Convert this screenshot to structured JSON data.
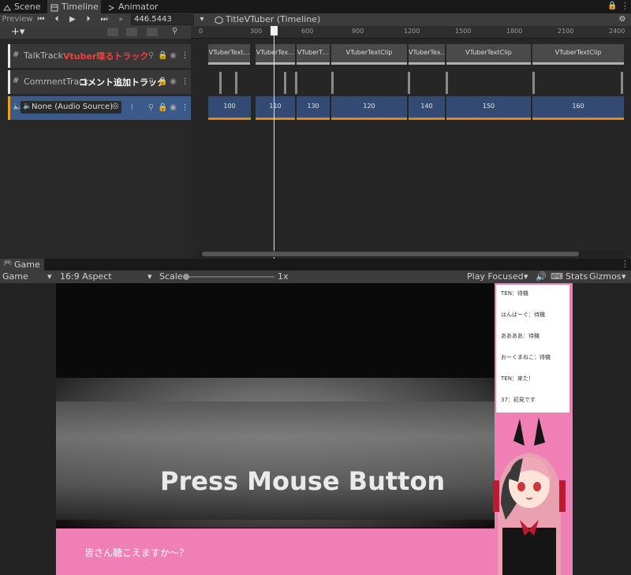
{
  "tabs": [
    {
      "label": "Scene"
    },
    {
      "label": "Timeline"
    },
    {
      "label": "Animator"
    }
  ],
  "toolbar": {
    "preview": "Preview",
    "time": "446.5443",
    "timeline_name": "TitleVTuber (Timeline)"
  },
  "ruler": {
    "ticks": [
      "0",
      "300",
      "600",
      "900",
      "1200",
      "1500",
      "1800",
      "2100",
      "2400"
    ]
  },
  "tracks": [
    {
      "name": "TalkTrack",
      "note": "Vtuber喋るトラック",
      "note_color": "#ff3030"
    },
    {
      "name": "CommentTrack",
      "note": "コメント追加トラック",
      "note_color": "#ffffff"
    },
    {
      "name": "None (Audio Source)"
    }
  ],
  "talk_clips": [
    "VTuberText…",
    "VTuberTex…",
    "VTuberT…",
    "VTuberTextClip",
    "VTuberTex…",
    "VTuberTextClip",
    "VTuberTextClip"
  ],
  "audio_clips": [
    "100",
    "110",
    "130",
    "120",
    "140",
    "150",
    "160"
  ],
  "game": {
    "tab": "Game",
    "display": "Game",
    "aspect": "16:9 Aspect",
    "scale_label": "Scale",
    "scale_value": "1x",
    "play_mode": "Play Focused",
    "stats": "Stats",
    "gizmos": "Gizmos"
  },
  "scene": {
    "press_text": "Press Mouse Button",
    "subtitle": "皆さん聴こえますか〜？",
    "chat": [
      "TEN：待機",
      "はんばーぐ：待機",
      "ああああ：待機",
      "おーくまねこ：待機",
      "TEN：来た！",
      "37：初見です"
    ]
  }
}
